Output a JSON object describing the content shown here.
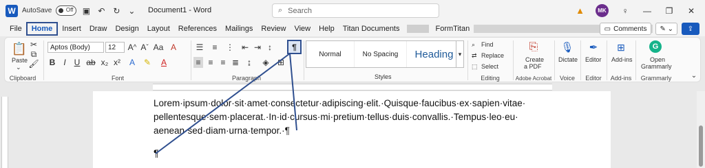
{
  "titlebar": {
    "autosave_label": "AutoSave",
    "autosave_state": "Off",
    "doc_title": "Document1 - Word",
    "search_placeholder": "Search",
    "avatar_initials": "MK"
  },
  "menu": {
    "items": [
      "File",
      "Home",
      "Insert",
      "Draw",
      "Design",
      "Layout",
      "References",
      "Mailings",
      "Review",
      "View",
      "Help",
      "Titan Documents",
      "FormTitan"
    ],
    "active": "Home",
    "comments_label": "Comments"
  },
  "ribbon": {
    "clipboard": {
      "paste_label": "Paste",
      "group_label": "Clipboard"
    },
    "font": {
      "font_name": "Aptos (Body)",
      "font_size": "12",
      "group_label": "Font"
    },
    "paragraph": {
      "group_label": "Paragraph",
      "pilcrow": "¶"
    },
    "styles": {
      "items": [
        "Normal",
        "No Spacing",
        "Heading"
      ],
      "group_label": "Styles"
    },
    "editing": {
      "find": "Find",
      "replace": "Replace",
      "select": "Select",
      "group_label": "Editing"
    },
    "acrobat": {
      "label1": "Create",
      "label2": "a PDF",
      "group_label": "Adobe Acrobat"
    },
    "voice": {
      "label": "Dictate",
      "group_label": "Voice"
    },
    "editor": {
      "label": "Editor",
      "group_label": "Editor"
    },
    "addins": {
      "label": "Add-ins",
      "group_label": "Add-ins"
    },
    "grammarly": {
      "label1": "Open",
      "label2": "Grammarly",
      "group_label": "Grammarly"
    }
  },
  "document": {
    "line1": "Lorem·ipsum·dolor·sit·amet·consectetur·adipiscing·elit.·Quisque·faucibus·ex·sapien·vitae·",
    "line2": "pellentesque·sem·placerat.·In·id·cursus·mi·pretium·tellus·duis·convallis.·Tempus·leo·eu·",
    "line3": "aenean·sed·diam·urna·tempor.·¶",
    "empty_paragraph": "¶"
  },
  "colors": {
    "accent": "#185abd",
    "highlight_box": "#2f4f8f"
  }
}
